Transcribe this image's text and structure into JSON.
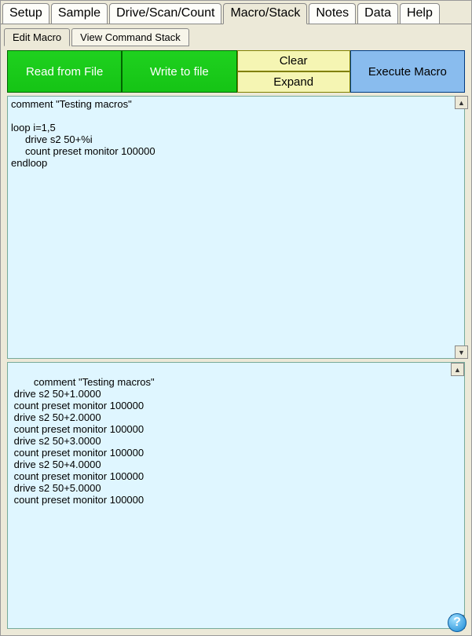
{
  "main_tabs": {
    "setup": "Setup",
    "sample": "Sample",
    "drive": "Drive/Scan/Count",
    "macro": "Macro/Stack",
    "notes": "Notes",
    "data": "Data",
    "help": "Help"
  },
  "sub_tabs": {
    "edit": "Edit Macro",
    "view": "View Command Stack"
  },
  "toolbar": {
    "read": "Read from File",
    "write": "Write to file",
    "clear": "Clear",
    "expand": "Expand",
    "execute": "Execute Macro"
  },
  "editor_text": "comment \"Testing macros\"\n\nloop i=1,5\n     drive s2 50+%i\n     count preset monitor 100000\nendloop",
  "output_text": "comment \"Testing macros\"\n drive s2 50+1.0000\n count preset monitor 100000\n drive s2 50+2.0000\n count preset monitor 100000\n drive s2 50+3.0000\n count preset monitor 100000\n drive s2 50+4.0000\n count preset monitor 100000\n drive s2 50+5.0000\n count preset monitor 100000",
  "help_glyph": "?"
}
